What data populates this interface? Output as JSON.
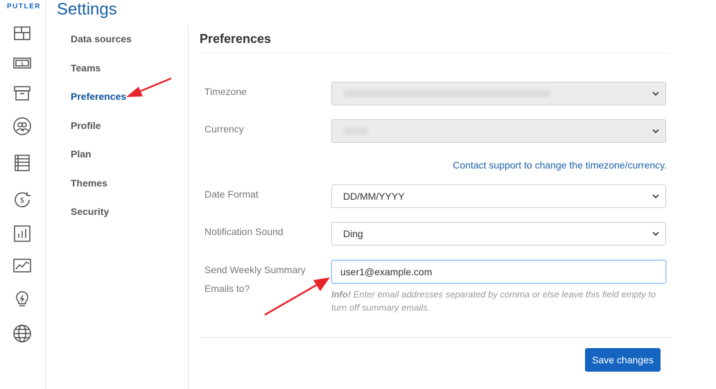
{
  "brand": "PUTLER",
  "page_title": "Settings",
  "rail_icons": [
    "dashboard-icon",
    "sales-icon",
    "products-icon",
    "customers-icon",
    "transactions-icon",
    "subscriptions-icon",
    "reports-icon",
    "analytics-icon",
    "insights-icon",
    "global-icon"
  ],
  "settings_nav": {
    "items": [
      {
        "label": "Data sources",
        "active": false
      },
      {
        "label": "Teams",
        "active": false
      },
      {
        "label": "Preferences",
        "active": true
      },
      {
        "label": "Profile",
        "active": false
      },
      {
        "label": "Plan",
        "active": false
      },
      {
        "label": "Themes",
        "active": false
      },
      {
        "label": "Security",
        "active": false
      }
    ]
  },
  "preferences": {
    "title": "Preferences",
    "timezone": {
      "label": "Timezone",
      "value": ""
    },
    "currency": {
      "label": "Currency",
      "value": ""
    },
    "support_link": "Contact support to change the timezone/currency.",
    "date_format": {
      "label": "Date Format",
      "value": "DD/MM/YYYY"
    },
    "notification_sound": {
      "label": "Notification Sound",
      "value": "Ding"
    },
    "weekly_summary": {
      "label_line1": "Send Weekly Summary",
      "label_line2": "Emails to?",
      "value": "user1@example.com",
      "info_prefix": "Info!",
      "info_text": " Enter email addresses separated by comma or else leave this field empty to turn off summary emails."
    },
    "save_label": "Save changes"
  },
  "colors": {
    "accent": "#1565c0",
    "title_blue": "#1a5fa8",
    "annotation_arrow": "#e8242b"
  }
}
